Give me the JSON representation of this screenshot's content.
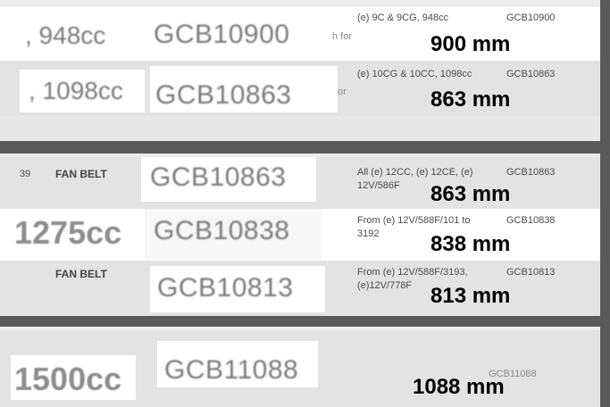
{
  "panels": [
    {
      "rows": [
        {
          "cc": ", 948cc",
          "code": "GCB10900",
          "frag": "h for",
          "desc": "(e) 9C & 9CG, 948cc",
          "ref": "GCB10900",
          "length": "900 mm"
        },
        {
          "cc": ", 1098cc",
          "code": "GCB10863",
          "frag": "or",
          "desc": "(e) 10CG & 10CC, 1098cc",
          "ref": "GCB10863",
          "length": "863 mm"
        }
      ]
    },
    {
      "rows": [
        {
          "num": "39",
          "label": "FAN BELT",
          "code": "GCB10863",
          "desc1": "All (e) 12CC, (e) 12CE, (e)",
          "desc2": "12V/586F",
          "ref": "GCB10863",
          "length": "863 mm"
        },
        {
          "cc": "1275cc",
          "code": "GCB10838",
          "desc1": "From (e) 12V/588F/101 to",
          "desc2": "3192",
          "ref": "GCB10838",
          "length": "838 mm"
        },
        {
          "label": "FAN BELT",
          "code": "GCB10813",
          "desc1": "From (e) 12V/588F/3193,",
          "desc2": "(e)12V/778F",
          "ref": "GCB10813",
          "length": "813 mm"
        }
      ]
    },
    {
      "rows": [
        {
          "cc": "1500cc",
          "code": "GCB11088",
          "ref": "GCB11088",
          "length": "1088 mm"
        }
      ]
    }
  ]
}
